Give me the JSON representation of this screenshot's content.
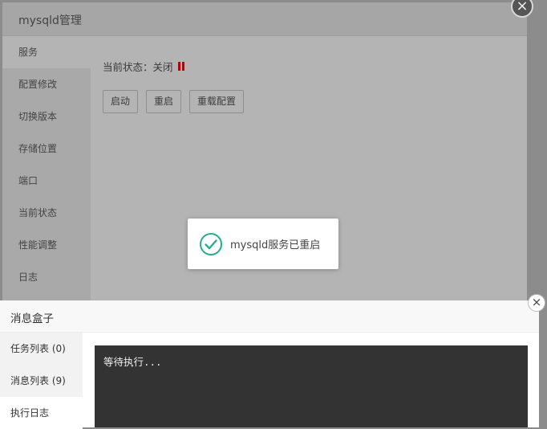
{
  "panel": {
    "title": "mysqld管理",
    "close_icon": "close-icon",
    "menu": [
      {
        "label": "服务",
        "active": true
      },
      {
        "label": "配置修改",
        "active": false
      },
      {
        "label": "切换版本",
        "active": false
      },
      {
        "label": "存储位置",
        "active": false
      },
      {
        "label": "端口",
        "active": false
      },
      {
        "label": "当前状态",
        "active": false
      },
      {
        "label": "性能调整",
        "active": false
      },
      {
        "label": "日志",
        "active": false
      }
    ],
    "status_label": "当前状态：关闭",
    "status_icon": "pause-icon",
    "status_color": "#c00000",
    "buttons": {
      "start": "启动",
      "restart": "重启",
      "reload": "重载配置"
    }
  },
  "toast": {
    "icon": "check-circle-icon",
    "icon_color": "#20b08f",
    "message": "mysqld服务已重启"
  },
  "msgbox": {
    "title": "消息盒子",
    "close_icon": "close-icon",
    "tabs": [
      {
        "label": "任务列表 (0)",
        "active": false
      },
      {
        "label": "消息列表 (9)",
        "active": false
      },
      {
        "label": "执行日志",
        "active": true
      }
    ],
    "log_text": "等待执行..."
  }
}
